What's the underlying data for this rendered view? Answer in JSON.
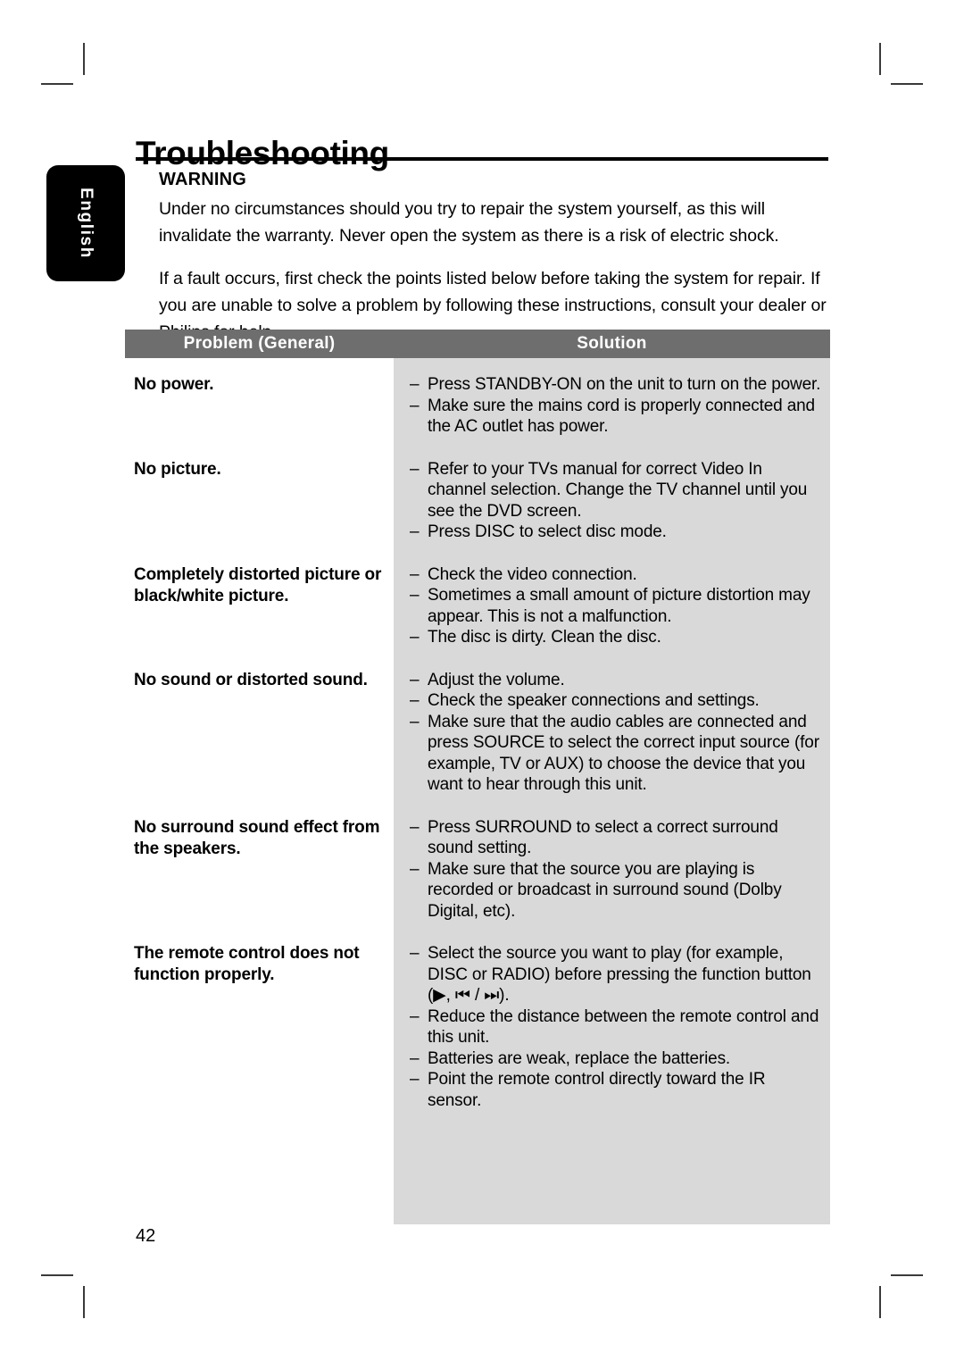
{
  "page": {
    "title": "Troubleshooting",
    "number": "42",
    "language_tab": "English"
  },
  "warning": {
    "heading": "WARNING",
    "paragraph1": "Under no circumstances should you try to repair the system yourself, as this will invalidate the warranty. Never open the system as there is a risk of electric shock.",
    "paragraph2": "If a fault occurs, first check the points listed below before taking the system for repair. If you are unable to solve a problem by following these instructions, consult your dealer or Philips for help."
  },
  "table": {
    "headers": {
      "problem": "Problem (General)",
      "solution": "Solution"
    },
    "header_bg": "#6e6e6e",
    "solution_bg": "#d9d9d9",
    "dash": "–",
    "rows": [
      {
        "problem": "No power.",
        "solutions": [
          "Press STANDBY-ON on the unit to turn on the power.",
          "Make sure the mains cord is properly connected and the AC outlet has power."
        ]
      },
      {
        "problem": "No picture.",
        "solutions": [
          "Refer to your TVs manual for correct Video In channel selection. Change the TV channel until you see the DVD screen.",
          "Press DISC to select disc mode."
        ]
      },
      {
        "problem": "Completely distorted picture or black/white picture.",
        "solutions": [
          "Check the video connection.",
          "Sometimes a small amount of picture distortion may appear. This is not a malfunction.",
          "The disc is dirty. Clean the disc."
        ]
      },
      {
        "problem": "No sound or distorted sound.",
        "solutions": [
          "Adjust the volume.",
          "Check the speaker connections and settings.",
          "Make sure that the audio cables are connected and press SOURCE to select the correct input source (for example, TV or AUX) to choose the device that you want to hear through this unit."
        ]
      },
      {
        "problem": "No surround sound effect from the speakers.",
        "solutions": [
          "Press SURROUND to select a correct surround sound setting.",
          "Make sure that the source you are playing is recorded or broadcast in surround sound (Dolby Digital, etc)."
        ]
      },
      {
        "problem": "The remote control does not function properly.",
        "solutions": [
          "Select the source you want to play (for example, DISC or RADIO) before pressing the function button (▶, ⏮ / ⏭).",
          "Reduce the distance between the remote control and this unit.",
          "Batteries are weak, replace the batteries.",
          "Point the remote control directly toward the IR sensor."
        ]
      }
    ]
  }
}
